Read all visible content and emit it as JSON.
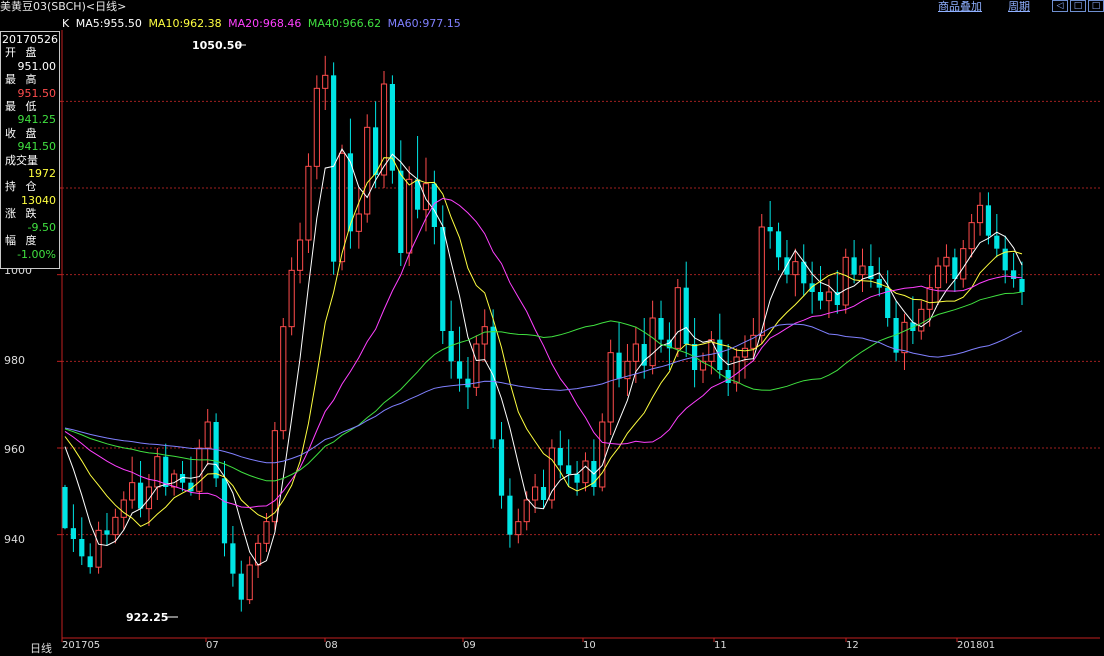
{
  "window": {
    "title": "美黄豆03(SBCH)<日线>",
    "overlay_link": "商品叠加",
    "period_link": "周期",
    "nav_left": "◁",
    "nav_right": "□"
  },
  "legend": {
    "k": "K",
    "ma5": "MA5:955.50",
    "ma10": "MA10:962.38",
    "ma20": "MA20:968.46",
    "ma40": "MA40:966.62",
    "ma60": "MA60:977.15"
  },
  "colors": {
    "up": "#ff4d4d",
    "down": "#00e5e5",
    "ma5": "#ffffff",
    "ma10": "#ffff40",
    "ma20": "#ff40ff",
    "ma40": "#40e040",
    "ma60": "#8080ff",
    "grid": "#a02020",
    "axis": "#c02020"
  },
  "info_panel": {
    "date": "20170526",
    "open_label": "开 盘",
    "open": "951.00",
    "high_label": "最 高",
    "high": "951.50",
    "low_label": "最 低",
    "low": "941.25",
    "close_label": "收 盘",
    "close": "941.50",
    "volume_label": "成交量",
    "volume": "1972",
    "oi_label": "持 仓",
    "oi": "13040",
    "change_label": "涨 跌",
    "change": "-9.50",
    "pct_label": "幅 度",
    "pct": "-1.00%"
  },
  "annotations": {
    "high_mark": "1050.50",
    "low_mark": "922.25"
  },
  "period_label": "日线",
  "chart_data": {
    "type": "candlestick",
    "ylim": [
      918,
      1056
    ],
    "y_ticks": [
      "940",
      "960",
      "980",
      "1000"
    ],
    "x_labels": [
      "201705",
      "07",
      "08",
      "09",
      "10",
      "11",
      "12",
      "201801"
    ],
    "candles": [
      [
        951,
        951.5,
        941.25,
        941.5
      ],
      [
        941.5,
        947,
        936,
        939
      ],
      [
        939,
        944,
        933,
        935
      ],
      [
        935,
        938,
        931,
        932.5
      ],
      [
        932.5,
        943,
        931,
        941
      ],
      [
        941,
        945,
        937.5,
        940
      ],
      [
        940,
        946,
        938,
        944
      ],
      [
        944,
        950,
        941,
        948
      ],
      [
        948,
        958,
        946,
        952
      ],
      [
        952,
        957,
        944,
        946
      ],
      [
        946,
        954,
        942,
        951
      ],
      [
        951,
        960,
        948,
        958
      ],
      [
        958,
        961,
        949,
        951
      ],
      [
        951,
        955,
        949,
        954
      ],
      [
        954,
        957,
        950,
        952
      ],
      [
        952,
        958,
        949,
        950
      ],
      [
        950,
        962,
        948,
        960
      ],
      [
        960,
        969,
        956,
        966
      ],
      [
        966,
        968,
        951,
        953
      ],
      [
        953,
        957,
        935,
        938
      ],
      [
        938,
        942,
        928,
        931
      ],
      [
        931,
        934,
        922.25,
        925
      ],
      [
        925,
        935,
        924,
        933
      ],
      [
        933,
        940,
        930,
        938
      ],
      [
        938,
        945,
        936,
        943
      ],
      [
        943,
        966,
        941,
        964
      ],
      [
        964,
        990,
        962,
        988
      ],
      [
        988,
        1004,
        986,
        1001
      ],
      [
        1001,
        1012,
        998,
        1008
      ],
      [
        1008,
        1028,
        1005,
        1025
      ],
      [
        1025,
        1046,
        1022,
        1043
      ],
      [
        1043,
        1050.5,
        1038,
        1046
      ],
      [
        1046,
        1049,
        1000,
        1003
      ],
      [
        1003,
        1030,
        1001,
        1028
      ],
      [
        1028,
        1036,
        1006,
        1010
      ],
      [
        1010,
        1020,
        1006,
        1014
      ],
      [
        1014,
        1037,
        1012,
        1034
      ],
      [
        1034,
        1040,
        1020,
        1023
      ],
      [
        1023,
        1047,
        1020,
        1044
      ],
      [
        1044,
        1046,
        1021,
        1024
      ],
      [
        1024,
        1031,
        1002,
        1005
      ],
      [
        1005,
        1025,
        1002,
        1022
      ],
      [
        1022,
        1032,
        1013,
        1015
      ],
      [
        1015,
        1027,
        1010,
        1021
      ],
      [
        1021,
        1024,
        1007,
        1011
      ],
      [
        1011,
        1016,
        984,
        987
      ],
      [
        987,
        994,
        976,
        980
      ],
      [
        980,
        988,
        973,
        976
      ],
      [
        976,
        981,
        969,
        974
      ],
      [
        974,
        986,
        972,
        984
      ],
      [
        984,
        992,
        980,
        988
      ],
      [
        988,
        992,
        960,
        962
      ],
      [
        962,
        966,
        946,
        949
      ],
      [
        949,
        953,
        937,
        940
      ],
      [
        940,
        946,
        938,
        943
      ],
      [
        943,
        950,
        941,
        948
      ],
      [
        948,
        954,
        945,
        951
      ],
      [
        951,
        955,
        946,
        948
      ],
      [
        948,
        962,
        946,
        960
      ],
      [
        960,
        964,
        953,
        956
      ],
      [
        956,
        962,
        951,
        954
      ],
      [
        954,
        957,
        949,
        952
      ],
      [
        952,
        959,
        950,
        957
      ],
      [
        957,
        962,
        949,
        951
      ],
      [
        951,
        968,
        950,
        966
      ],
      [
        966,
        985,
        963,
        982
      ],
      [
        982,
        989,
        974,
        976
      ],
      [
        976,
        984,
        972,
        980
      ],
      [
        980,
        988,
        975,
        984
      ],
      [
        984,
        990,
        976,
        979
      ],
      [
        979,
        994,
        977,
        990
      ],
      [
        990,
        994,
        982,
        985
      ],
      [
        985,
        989,
        978,
        983
      ],
      [
        983,
        999,
        981,
        997
      ],
      [
        997,
        1003,
        981,
        984
      ],
      [
        984,
        990,
        974,
        978
      ],
      [
        978,
        982,
        975,
        980
      ],
      [
        980,
        987,
        977,
        985
      ],
      [
        985,
        991,
        976,
        978
      ],
      [
        978,
        984,
        972,
        975
      ],
      [
        975,
        983,
        973,
        981
      ],
      [
        981,
        986,
        976,
        983
      ],
      [
        983,
        990,
        980,
        986
      ],
      [
        986,
        1014,
        984,
        1011
      ],
      [
        1011,
        1017,
        1006,
        1010
      ],
      [
        1010,
        1012,
        1001,
        1004
      ],
      [
        1004,
        1008,
        998,
        1000
      ],
      [
        1000,
        1006,
        995,
        1003
      ],
      [
        1003,
        1007,
        995,
        998
      ],
      [
        998,
        1003,
        991,
        996
      ],
      [
        996,
        1002,
        992,
        994
      ],
      [
        994,
        999,
        990,
        996
      ],
      [
        996,
        1001,
        991,
        993
      ],
      [
        993,
        1006,
        991,
        1004
      ],
      [
        1004,
        1008,
        998,
        1000
      ],
      [
        1000,
        1006,
        996,
        1002
      ],
      [
        1002,
        1007,
        997,
        999
      ],
      [
        999,
        1004,
        995,
        997
      ],
      [
        997,
        1001,
        988,
        990
      ],
      [
        990,
        994,
        980,
        982
      ],
      [
        982,
        991,
        978,
        989
      ],
      [
        989,
        995,
        984,
        987
      ],
      [
        987,
        994,
        985,
        992
      ],
      [
        992,
        1000,
        988,
        997
      ],
      [
        997,
        1004,
        993,
        1002
      ],
      [
        1002,
        1007,
        998,
        1004
      ],
      [
        1004,
        1006,
        996,
        999
      ],
      [
        999,
        1008,
        997,
        1006
      ],
      [
        1006,
        1014,
        1004,
        1012
      ],
      [
        1012,
        1019,
        1009,
        1016
      ],
      [
        1016,
        1019,
        1007,
        1009
      ],
      [
        1009,
        1014,
        1004,
        1006
      ],
      [
        1006,
        1009,
        998,
        1001
      ],
      [
        1001,
        1005,
        997,
        999
      ],
      [
        999,
        1003,
        993,
        996
      ]
    ]
  }
}
